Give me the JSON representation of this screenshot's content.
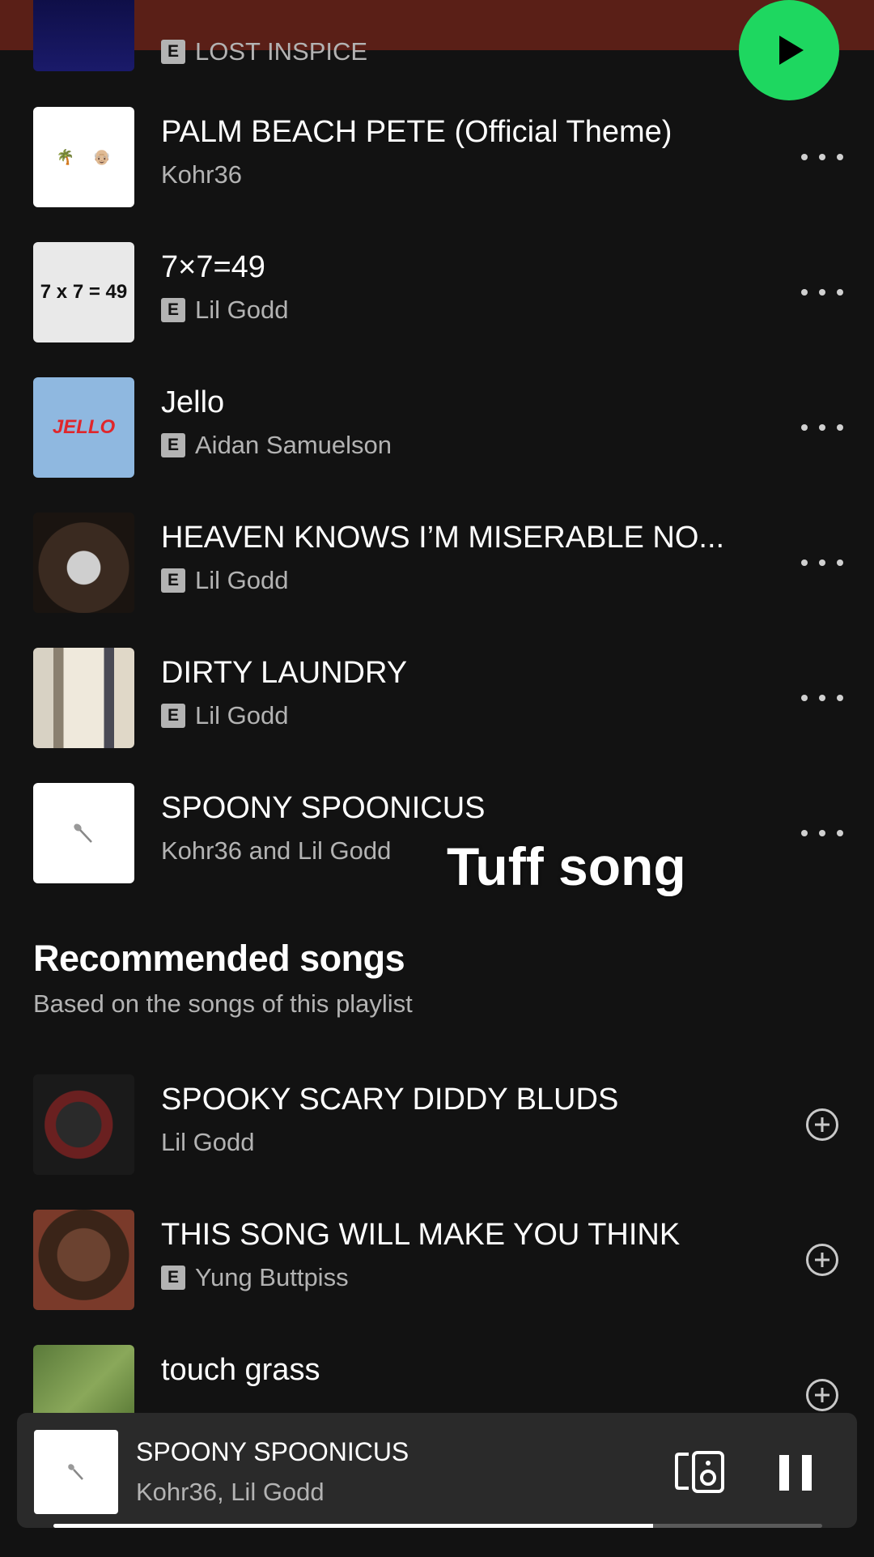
{
  "colors": {
    "bg": "#121212",
    "accent": "#1ed760",
    "header": "#5a1f17"
  },
  "header": {
    "partial_track_artist": "LOST INSPICE"
  },
  "tracks": [
    {
      "title": "PALM BEACH PETE (Official Theme)",
      "artist": "Kohr36",
      "explicit": false,
      "cover_text": "🌴🏝👴🏼"
    },
    {
      "title": "7×7=49",
      "artist": "Lil Godd",
      "explicit": true,
      "cover_text": "7 x 7 = 49"
    },
    {
      "title": "Jello",
      "artist": "Aidan Samuelson",
      "explicit": true,
      "cover_text": "JELLO"
    },
    {
      "title": "HEAVEN KNOWS I’M MISERABLE NO...",
      "artist": "Lil Godd",
      "explicit": true
    },
    {
      "title": "DIRTY LAUNDRY",
      "artist": "Lil Godd",
      "explicit": true
    },
    {
      "title": "SPOONY SPOONICUS",
      "artist": "Kohr36 and Lil Godd",
      "explicit": false
    }
  ],
  "overlay_caption": "Tuff song",
  "recommended": {
    "title": "Recommended songs",
    "subtitle": "Based on the songs of this playlist",
    "items": [
      {
        "title": "SPOOKY SCARY DIDDY BLUDS",
        "artist": "Lil Godd",
        "explicit": false
      },
      {
        "title": "THIS SONG WILL MAKE YOU THINK",
        "artist": "Yung Buttpiss",
        "explicit": true
      },
      {
        "title": "touch grass",
        "artist": "",
        "explicit": true
      }
    ]
  },
  "explicit_label": "E",
  "mini_player": {
    "title": "SPOONY SPOONICUS",
    "artist": "Kohr36, Lil Godd",
    "progress": 0.78
  }
}
